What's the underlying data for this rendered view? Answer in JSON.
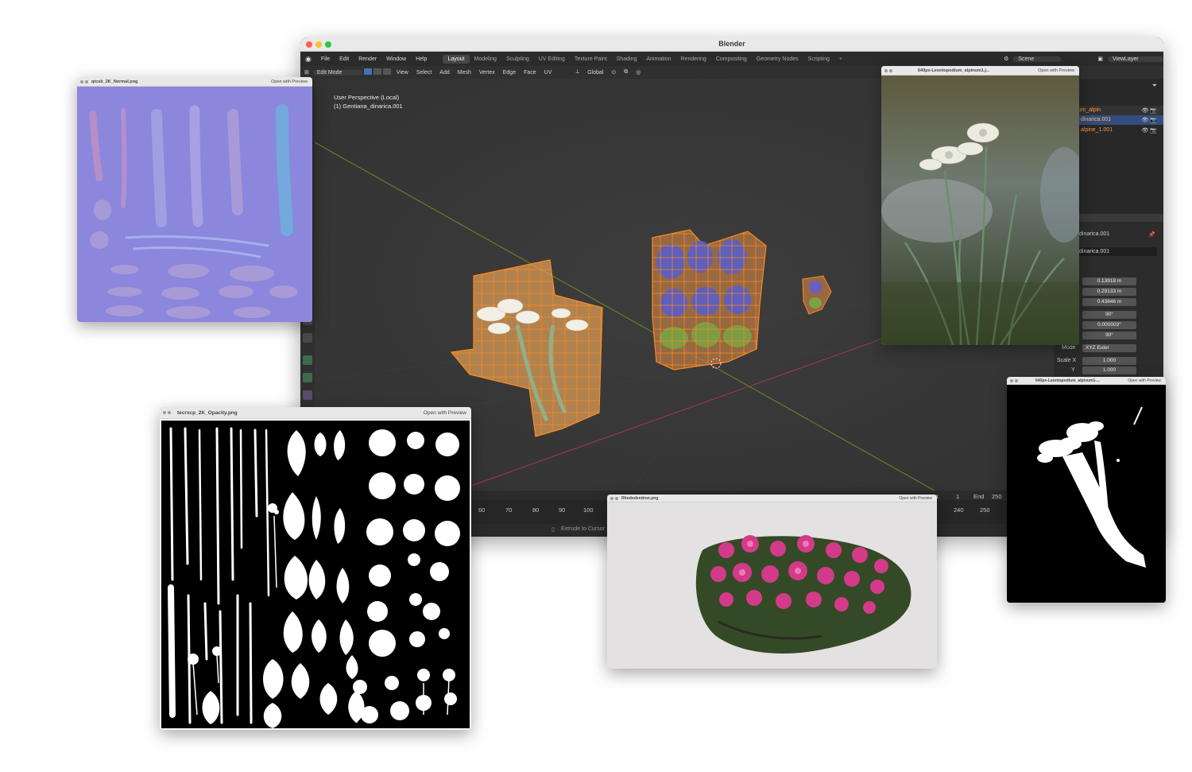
{
  "blender": {
    "title": "Blender",
    "menu": [
      "File",
      "Edit",
      "Render",
      "Window",
      "Help"
    ],
    "workspaces": [
      "Layout",
      "Modeling",
      "Sculpting",
      "UV Editing",
      "Texture Paint",
      "Shading",
      "Animation",
      "Rendering",
      "Compositing",
      "Geometry Nodes",
      "Scripting"
    ],
    "active_workspace": "Layout",
    "scene": "Scene",
    "viewlayer": "ViewLayer",
    "header": {
      "mode": "Edit Mode",
      "items": [
        "View",
        "Select",
        "Add",
        "Mesh",
        "Vertex",
        "Edge",
        "Face",
        "UV"
      ],
      "orientation": "Global"
    },
    "viewport": {
      "perspective": "User Perspective (Local)",
      "object": "(1) Gentiana_dinarica.001"
    },
    "outliner": [
      "Leontopodium_alpin",
      "dinarica.001",
      "alpine_1.001"
    ],
    "properties": {
      "object_name": "dinarica.001",
      "mesh_name": "dinarica.001",
      "location": [
        "0.13918 m",
        "0.29133 m",
        "0.43846 m"
      ],
      "rotation": [
        "90°",
        "0.000003°",
        "90°"
      ],
      "mode_label": "Mode",
      "mode_value": "XYZ Euler",
      "scale_x_label": "Scale X",
      "scale_x": "1.000",
      "scale_y_label": "Y",
      "scale_y": "1.000"
    },
    "timeline": {
      "ticks": [
        "60",
        "70",
        "80",
        "90",
        "100"
      ],
      "ticks_right": [
        "240",
        "250"
      ],
      "start_label": "rt",
      "start": "1",
      "end_label": "End",
      "end": "250"
    },
    "status": "Extrude to Cursor"
  },
  "windows": {
    "normal": {
      "name": "qtcsb_2K_Normal.png",
      "open": "Open with Preview"
    },
    "opacity": {
      "name": "tecrxcp_2K_Opacity.png",
      "open": "Open with Preview"
    },
    "edelweiss": {
      "name": "640px-Leontopodium_alpinum1.j...",
      "open": "Open with Preview"
    },
    "mask": {
      "name": "640px-Leontopodium_alpinum1-...",
      "open": "Open with Preview"
    },
    "rhododendron": {
      "name": "Rhododendron.png",
      "open": "Open with Preview"
    }
  }
}
